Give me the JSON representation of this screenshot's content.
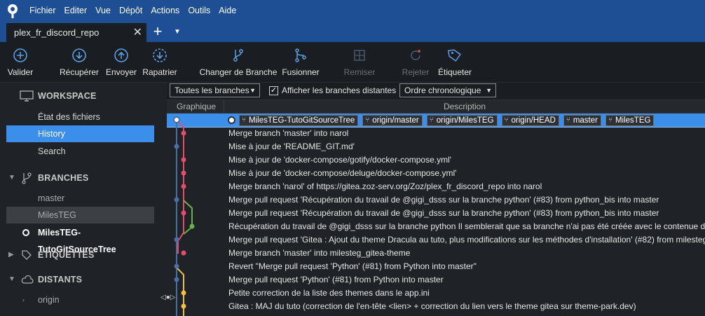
{
  "menubar": {
    "items": [
      "Fichier",
      "Editer",
      "Vue",
      "Dépôt",
      "Actions",
      "Outils",
      "Aide"
    ]
  },
  "tab": {
    "title": "plex_fr_discord_repo",
    "close": "✕",
    "add": "+",
    "dropdown": "▼"
  },
  "toolbar": {
    "valider": "Valider",
    "recuperer": "Récupérer",
    "envoyer": "Envoyer",
    "rapatrier": "Rapatrier",
    "changer_branche": "Changer de Branche",
    "fusionner": "Fusionner",
    "remiser": "Remiser",
    "rejeter": "Rejeter",
    "etiqueter": "Étiqueter"
  },
  "sidebar": {
    "workspace": "WORKSPACE",
    "workspace_items": [
      "État des fichiers",
      "History",
      "Search"
    ],
    "branches": "BRANCHES",
    "branch_items": [
      "master",
      "MilesTEG",
      "MilesTEG-TutoGitSourceTree"
    ],
    "etiquettes": "ÉTIQUETTES",
    "distants": "DISTANTS",
    "remote_items": [
      "origin"
    ]
  },
  "filters": {
    "branches": "Toutes les branches",
    "show_remote": "Afficher les branches distantes",
    "order": "Ordre chronologique"
  },
  "columns": {
    "graph": "Graphique",
    "description": "Description"
  },
  "refs": [
    "MilesTEG-TutoGitSourceTree",
    "origin/master",
    "origin/MilesTEG",
    "origin/HEAD",
    "master",
    "MilesTEG"
  ],
  "commits": [
    "",
    "Merge branch 'master' into narol",
    "Mise à jour de 'README_GIT.md'",
    "Mise à jour de 'docker-compose/gotify/docker-compose.yml'",
    "Mise à jour de 'docker-compose/deluge/docker-compose.yml'",
    "Merge branch 'narol' of https://gitea.zoz-serv.org/Zoz/plex_fr_discord_repo into narol",
    "Merge pull request 'Récupération du travail de @gigi_dsss sur la branche python' (#83) from python_bis into master",
    "Merge pull request 'Récupération du travail de @gigi_dsss sur la branche python' (#83) from python_bis into master",
    "Récupération du travail de @gigi_dsss sur la branche python Il semblerait que sa branche n'ai pas été créée avec le contenue de la",
    "Merge pull request 'Gitea : Ajout du theme Dracula au tuto, plus modifications sur les méthodes d'installation' (#82) from milesteg",
    "Merge branch 'master' into milesteg_gitea-theme",
    "Revert \"Merge pull request 'Python' (#81) from Python into master\"",
    "Merge pull request 'Python' (#81) from Python into master",
    "Petite correction de la liste des themes dans le app.ini",
    "Gitea : MAJ du tuto (correction de l'en-tête <lien> + correction du lien vers le theme gitea sur theme-park.dev)"
  ],
  "colors": {
    "menubar": "#1e4e94",
    "selection": "#3b8eea",
    "graph_blue": "#4a6fa5",
    "graph_pink": "#e0506e",
    "graph_green": "#6ab04c",
    "graph_yellow": "#f0c040"
  }
}
